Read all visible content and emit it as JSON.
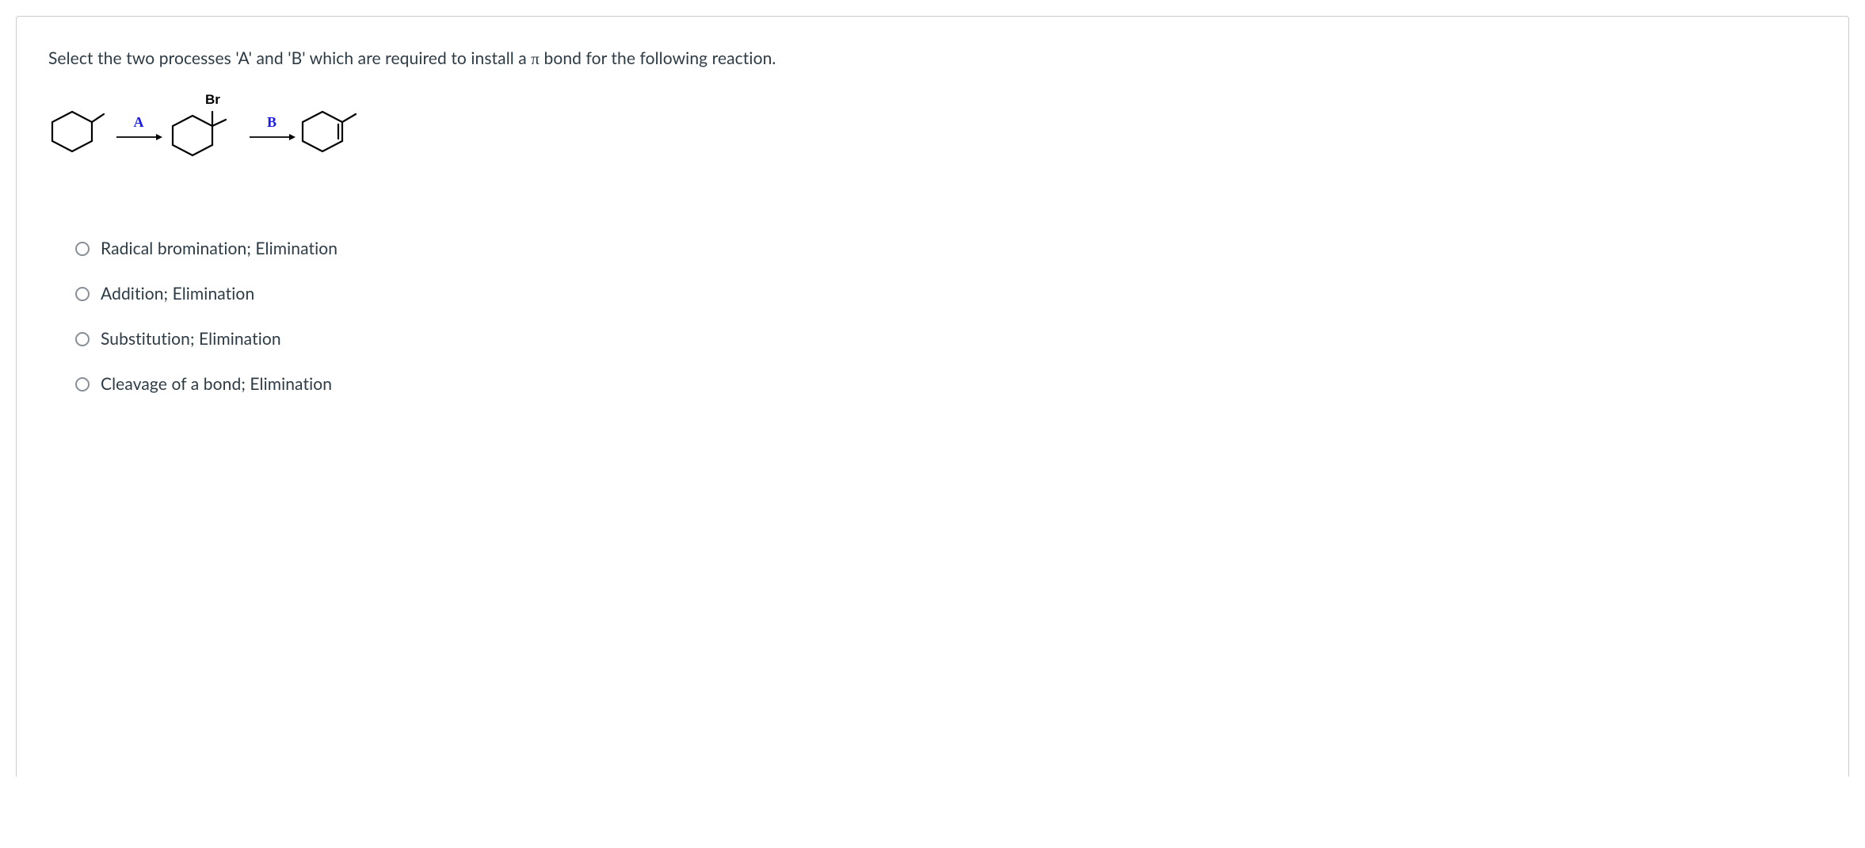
{
  "question": {
    "prompt_pre": "Select the two processes 'A' and 'B' which are required to install a ",
    "prompt_pi": "π",
    "prompt_post": " bond for the following reaction.",
    "reaction": {
      "step_a_label": "A",
      "step_b_label": "B",
      "intermediate_substituent": "Br"
    },
    "options": [
      {
        "label": "Radical bromination; Elimination"
      },
      {
        "label": "Addition; Elimination"
      },
      {
        "label": "Substitution; Elimination"
      },
      {
        "label": "Cleavage of a bond; Elimination"
      }
    ]
  }
}
